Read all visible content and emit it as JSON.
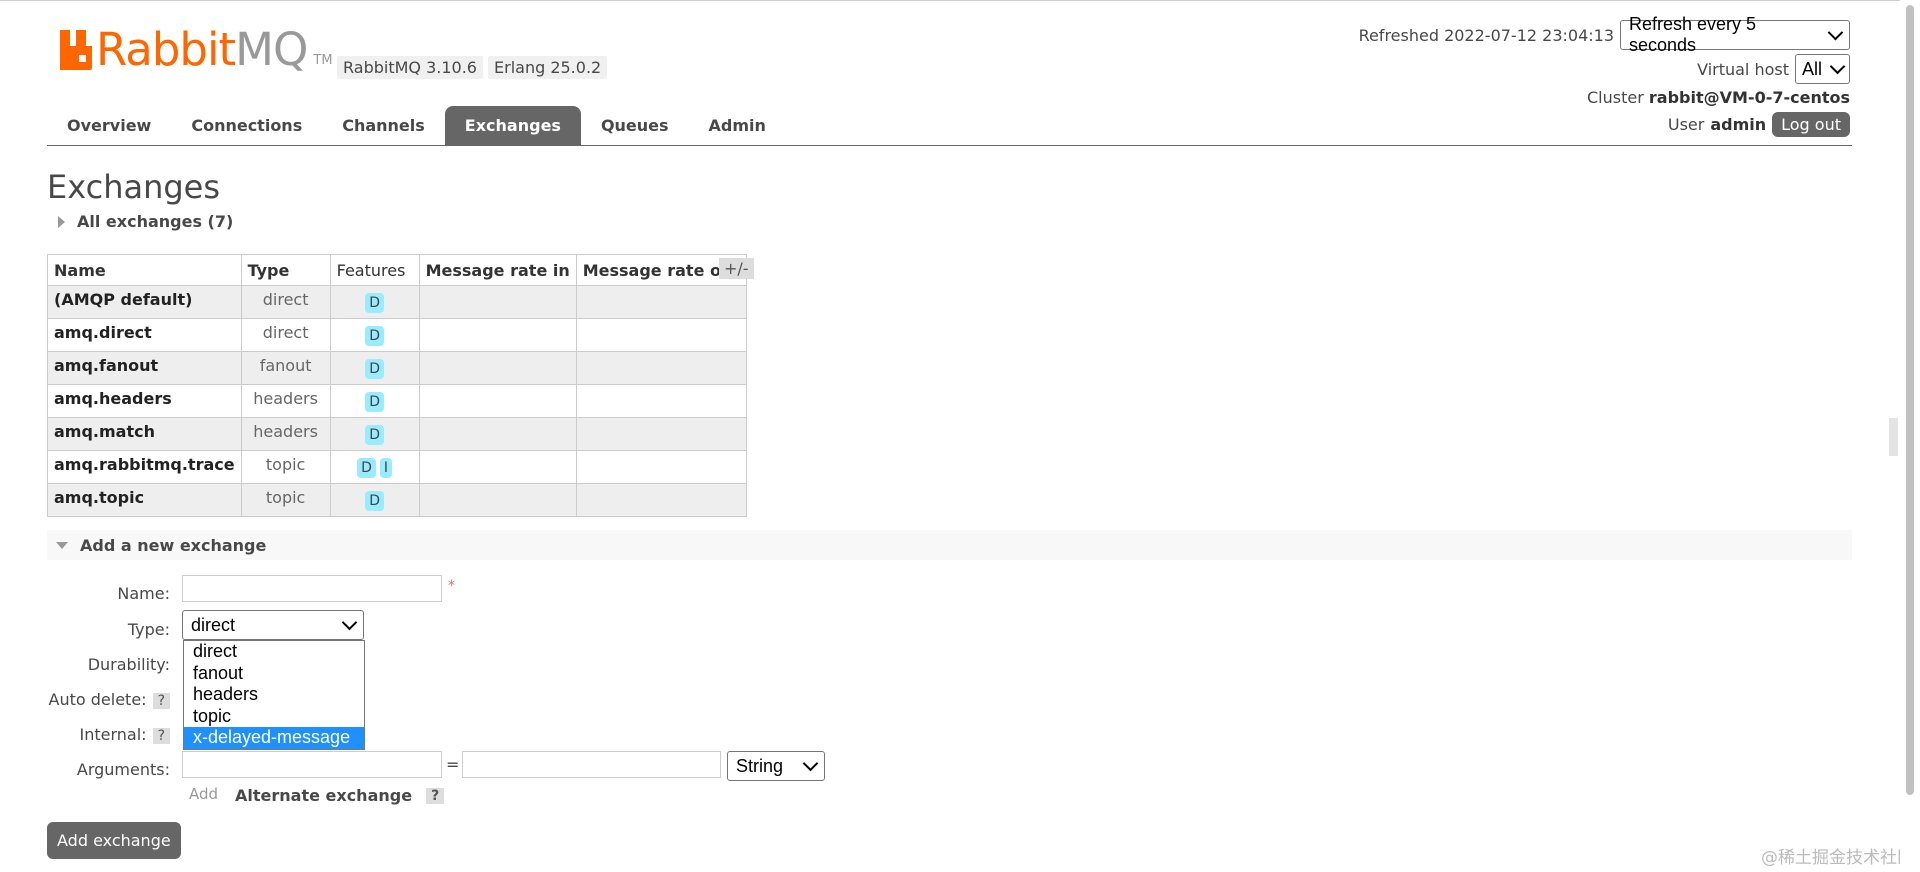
{
  "header": {
    "logo_name": "Rabbit",
    "logo_suffix": "MQ",
    "logo_tm": "TM",
    "version": "RabbitMQ 3.10.6",
    "erlang": "Erlang 25.0.2",
    "refreshed": "Refreshed 2022-07-12 23:04:13",
    "refresh_option": "Refresh every 5 seconds",
    "vhost_label": "Virtual host",
    "vhost_value": "All",
    "cluster_label": "Cluster",
    "cluster_value": "rabbit@VM-0-7-centos",
    "user_label": "User",
    "user_value": "admin",
    "logout": "Log out"
  },
  "nav": {
    "tabs": [
      "Overview",
      "Connections",
      "Channels",
      "Exchanges",
      "Queues",
      "Admin"
    ],
    "active": "Exchanges"
  },
  "page": {
    "title": "Exchanges",
    "all_exchanges": "All exchanges (7)"
  },
  "table": {
    "columns": [
      "Name",
      "Type",
      "Features",
      "Message rate in",
      "Message rate out"
    ],
    "toggle": "+/-",
    "rows": [
      {
        "name": "(AMQP default)",
        "type": "direct",
        "features": [
          "D"
        ]
      },
      {
        "name": "amq.direct",
        "type": "direct",
        "features": [
          "D"
        ]
      },
      {
        "name": "amq.fanout",
        "type": "fanout",
        "features": [
          "D"
        ]
      },
      {
        "name": "amq.headers",
        "type": "headers",
        "features": [
          "D"
        ]
      },
      {
        "name": "amq.match",
        "type": "headers",
        "features": [
          "D"
        ]
      },
      {
        "name": "amq.rabbitmq.trace",
        "type": "topic",
        "features": [
          "D",
          "I"
        ]
      },
      {
        "name": "amq.topic",
        "type": "topic",
        "features": [
          "D"
        ]
      }
    ]
  },
  "add_form": {
    "section_title": "Add a new exchange",
    "name_label": "Name:",
    "required_mark": "*",
    "type_label": "Type:",
    "type_value": "direct",
    "type_options": [
      "direct",
      "fanout",
      "headers",
      "topic",
      "x-delayed-message"
    ],
    "type_highlighted": "x-delayed-message",
    "durability_label": "Durability:",
    "auto_delete_label": "Auto delete:",
    "internal_label": "Internal:",
    "arguments_label": "Arguments:",
    "help": "?",
    "equals": "=",
    "arg_type": "String",
    "add_link": "Add",
    "alternate_exchange": "Alternate exchange",
    "submit": "Add exchange"
  },
  "watermark": "@稀土掘金技术社区"
}
